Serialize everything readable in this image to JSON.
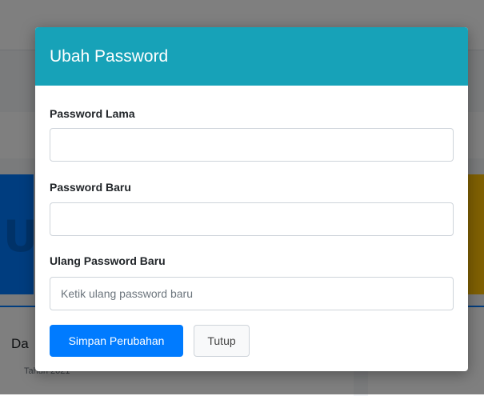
{
  "background": {
    "info_card_title": "Da",
    "info_card_subtitle": "Tahun 2021"
  },
  "modal": {
    "title": "Ubah Password",
    "fields": [
      {
        "label": "Password Lama",
        "value": "",
        "placeholder": ""
      },
      {
        "label": "Password Baru",
        "value": "",
        "placeholder": ""
      },
      {
        "label": "Ulang Password Baru",
        "value": "",
        "placeholder": "Ketik ulang password baru"
      }
    ],
    "save_label": "Simpan Perubahan",
    "close_label": "Tutup"
  },
  "colors": {
    "header": "#17a2b8",
    "primary": "#007bff",
    "warning": "#ffc107"
  }
}
